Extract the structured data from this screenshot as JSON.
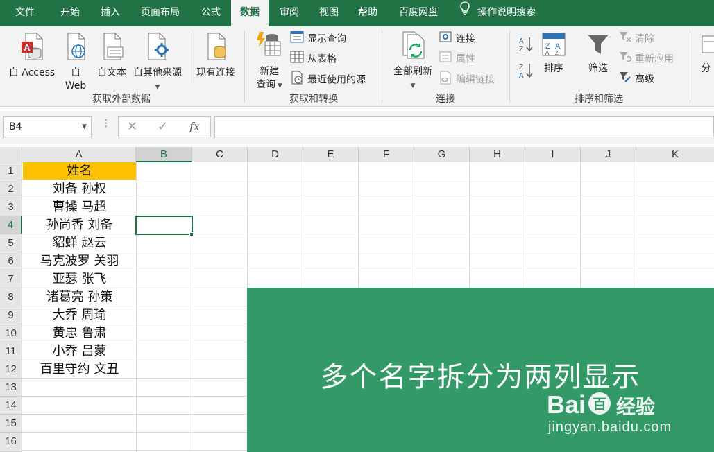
{
  "tabs": [
    {
      "label": "文件",
      "active": false
    },
    {
      "label": "开始",
      "active": false
    },
    {
      "label": "插入",
      "active": false
    },
    {
      "label": "页面布局",
      "active": false
    },
    {
      "label": "公式",
      "active": false
    },
    {
      "label": "数据",
      "active": true
    },
    {
      "label": "审阅",
      "active": false
    },
    {
      "label": "视图",
      "active": false
    },
    {
      "label": "帮助",
      "active": false
    },
    {
      "label": "百度网盘",
      "active": false
    }
  ],
  "tell_me": "操作说明搜索",
  "ribbon": {
    "external": {
      "group_label": "获取外部数据",
      "from_access": "自 Access",
      "from_web_1": "自",
      "from_web_2": "Web",
      "from_text": "自文本",
      "from_other": "自其他来源",
      "existing": "现有连接"
    },
    "transform": {
      "group_label": "获取和转换",
      "new_query_1": "新建",
      "new_query_2": "查询",
      "show_queries": "显示查询",
      "from_table": "从表格",
      "recent_sources": "最近使用的源"
    },
    "connections": {
      "group_label": "连接",
      "refresh_all": "全部刷新",
      "connections": "连接",
      "properties": "属性",
      "edit_links": "编辑链接"
    },
    "sortfilter": {
      "group_label": "排序和筛选",
      "sort": "排序",
      "filter": "筛选",
      "clear": "清除",
      "reapply": "重新应用",
      "advanced": "高级"
    },
    "more": "分"
  },
  "formula_bar": {
    "name_box": "B4",
    "fx": "fx",
    "value": ""
  },
  "columns": [
    "A",
    "B",
    "C",
    "D",
    "E",
    "F",
    "G",
    "H",
    "I",
    "J",
    "K"
  ],
  "selected_column": "B",
  "rows": [
    "1",
    "2",
    "3",
    "4",
    "5",
    "6",
    "7",
    "8",
    "9",
    "10",
    "11",
    "12",
    "13",
    "14",
    "15",
    "16"
  ],
  "selected_row": "4",
  "cells_a": [
    "姓名",
    "刘备  孙权",
    "曹操  马超",
    "孙尚香  刘备",
    "貂蝉  赵云",
    "马克波罗  关羽",
    "亚瑟  张飞",
    "诸葛亮  孙策",
    "大乔  周瑜",
    "黄忠  鲁肃",
    "小乔  吕蒙",
    "百里守约  文丑"
  ],
  "colors": {
    "brand": "#217346",
    "header_fill": "#ffc000",
    "banner": "#339966"
  },
  "banner": {
    "title": "多个名字拆分为两列显示",
    "watermark_logo": "Bai",
    "watermark_logo_tail": "百",
    "watermark_cn": "经验",
    "watermark_url": "jingyan.baidu.com"
  }
}
